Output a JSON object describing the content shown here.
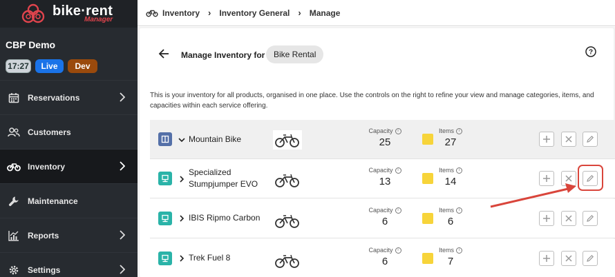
{
  "brand": {
    "name": "bike·rent",
    "sub": "Manager",
    "accent": "#e0444d"
  },
  "org": {
    "name": "CBP Demo",
    "time": "17:27",
    "live_label": "Live",
    "dev_label": "Dev"
  },
  "nav": {
    "items": [
      {
        "label": "Reservations",
        "icon": "calendar-icon"
      },
      {
        "label": "Customers",
        "icon": "users-icon"
      },
      {
        "label": "Inventory",
        "icon": "bicycle-icon"
      },
      {
        "label": "Maintenance",
        "icon": "wrench-icon"
      },
      {
        "label": "Reports",
        "icon": "chart-icon"
      },
      {
        "label": "Settings",
        "icon": "gear-icon"
      }
    ]
  },
  "breadcrumb": [
    "Inventory",
    "Inventory General",
    "Manage"
  ],
  "header": {
    "title": "Manage Inventory for",
    "service": "Bike Rental",
    "description": "This is your inventory for all products, organised in one place. Use the controls on the right to refine your view and manage categories, items, and capacities within each service offering."
  },
  "labels": {
    "capacity": "Capacity",
    "items": "Items"
  },
  "rows": [
    {
      "name": "Mountain Bike",
      "capacity": "25",
      "items": "27"
    },
    {
      "name_line1": "Specialized",
      "name_line2": "Stumpjumper EVO",
      "capacity": "13",
      "items": "14"
    },
    {
      "name": "IBIS Ripmo Carbon",
      "capacity": "6",
      "items": "6"
    },
    {
      "name": "Trek Fuel 8",
      "capacity": "6",
      "items": "7"
    }
  ],
  "colors": {
    "group_icon": "#5470a8",
    "item_icon": "#2ab3a8",
    "items_badge": "#f7d43a",
    "highlight": "#d9453b"
  }
}
